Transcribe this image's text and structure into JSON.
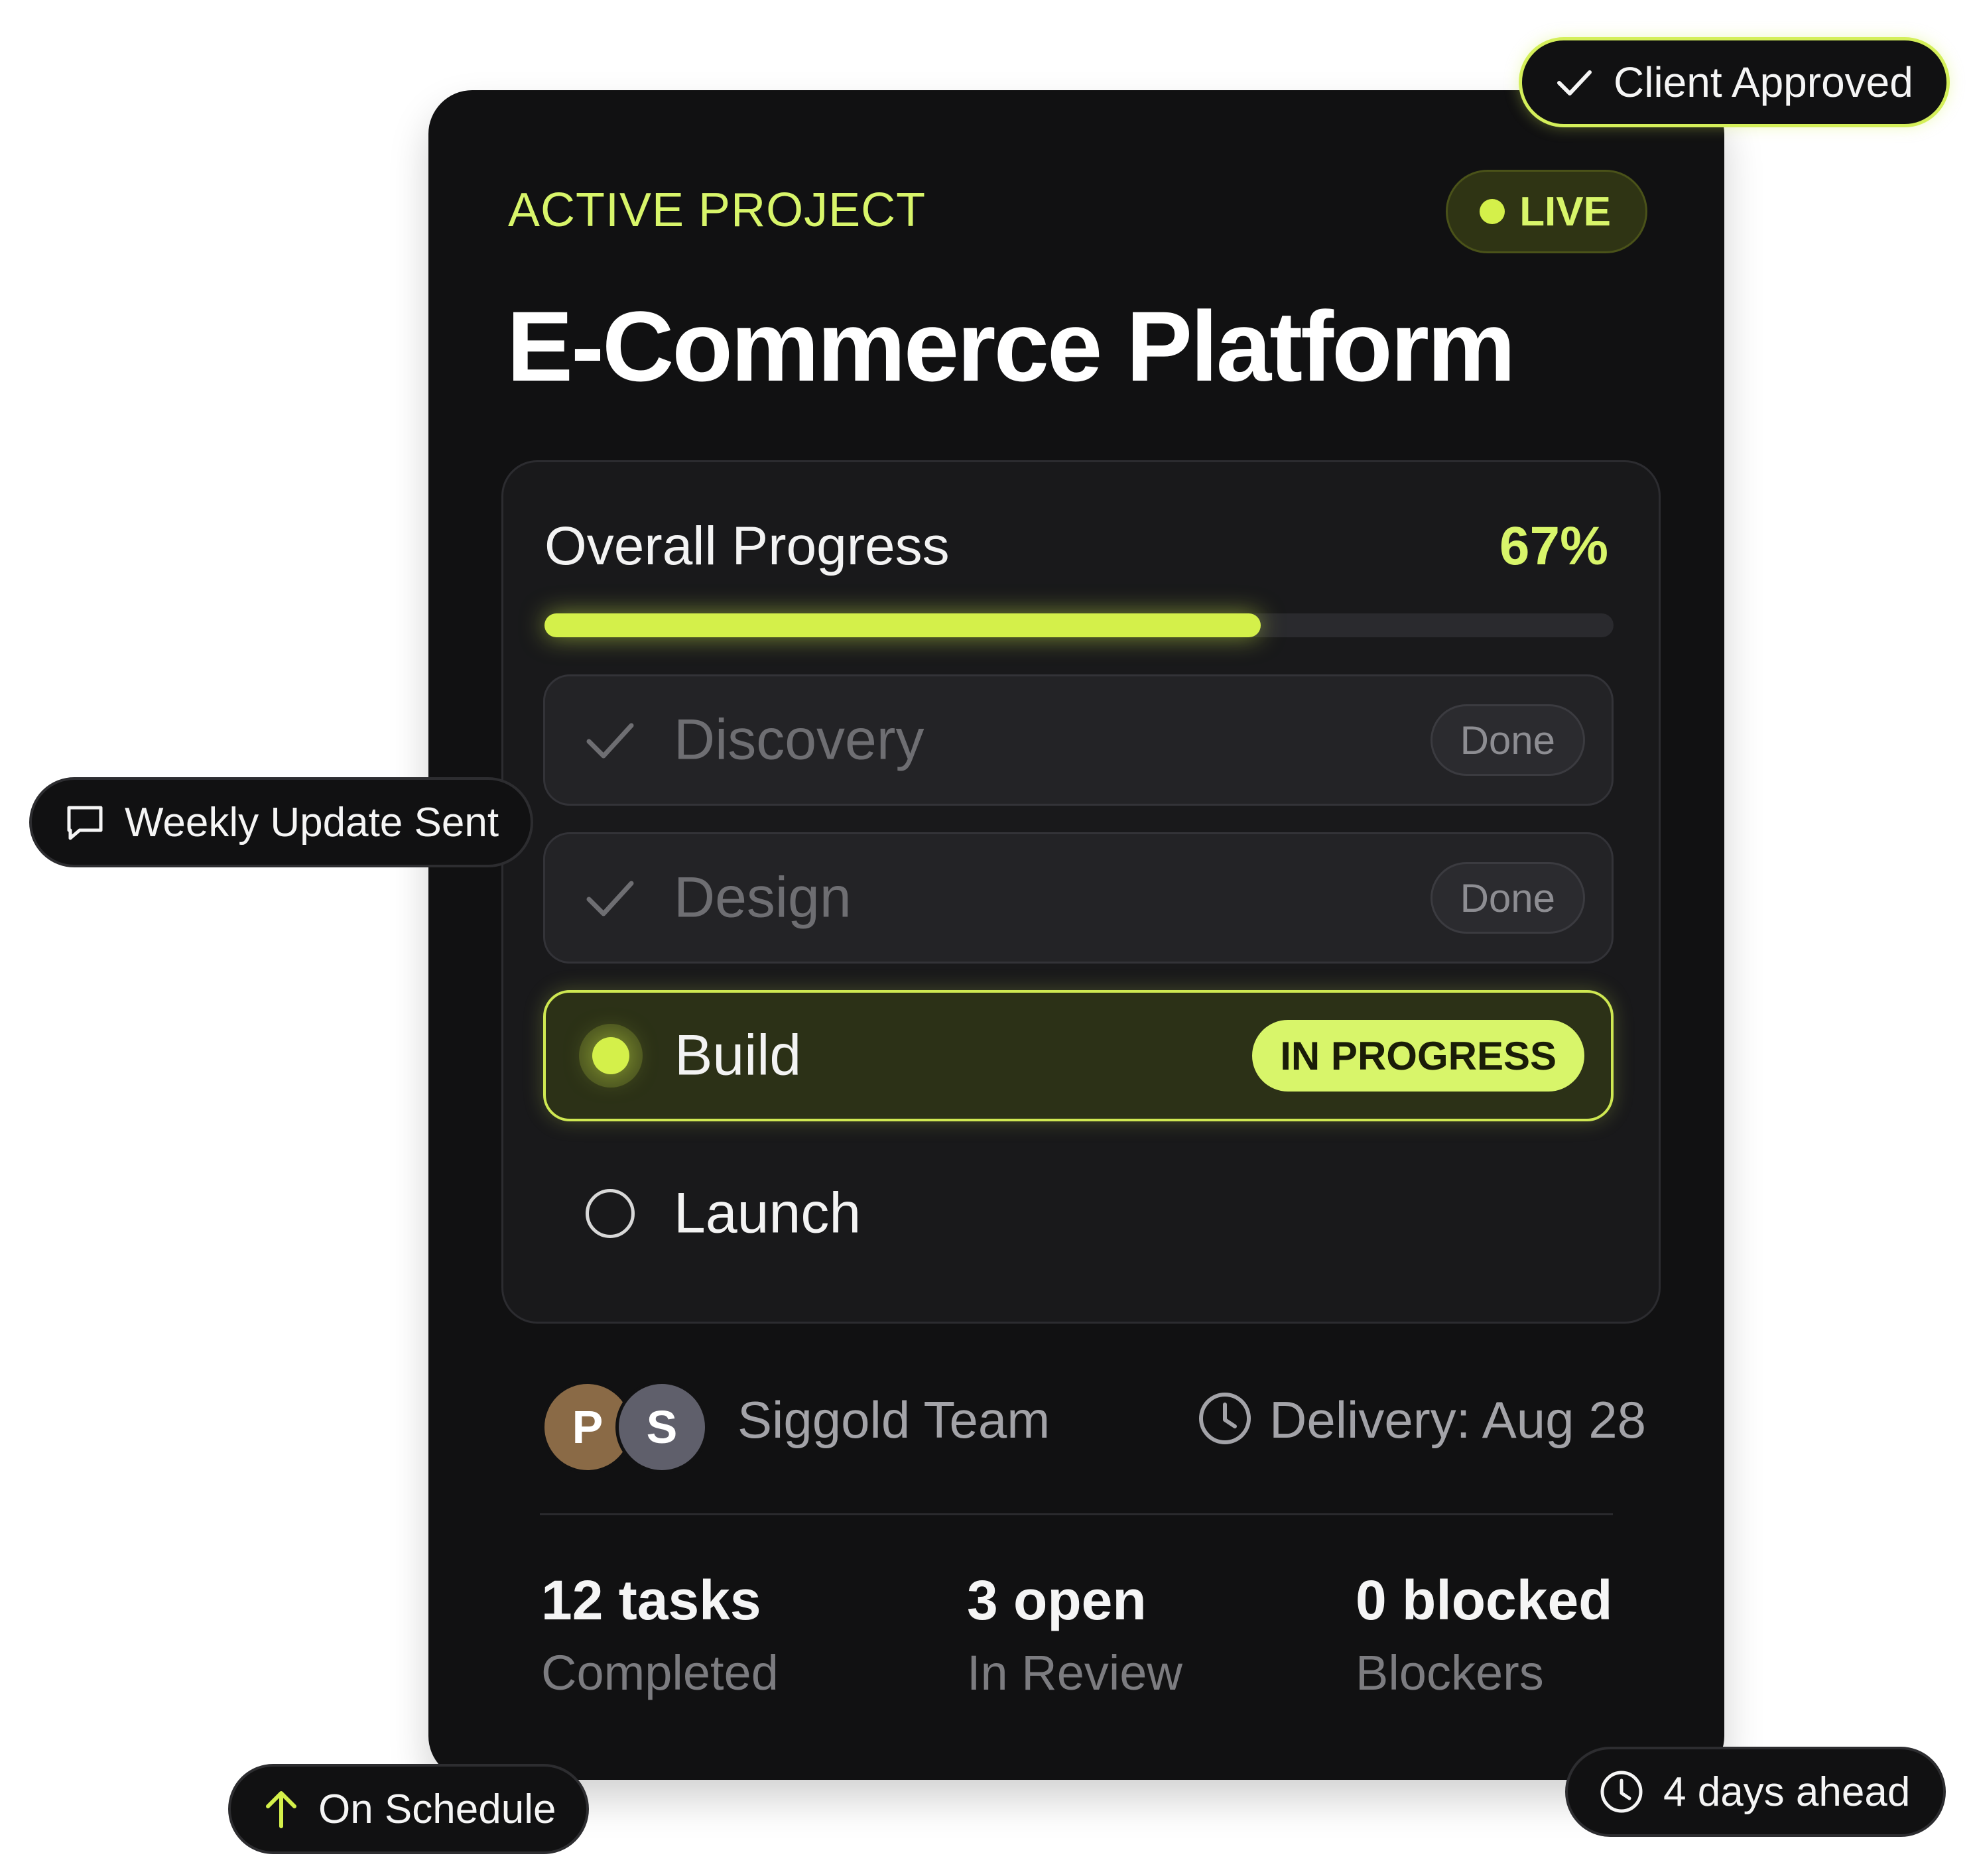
{
  "card": {
    "eyebrow": "ACTIVE PROJECT",
    "live_badge": "LIVE",
    "title": "E-Commerce Platform"
  },
  "progress": {
    "label": "Overall Progress",
    "value_text": "67%",
    "value_fraction": 0.67
  },
  "stages": [
    {
      "label": "Discovery",
      "status": "Done",
      "state": "done"
    },
    {
      "label": "Design",
      "status": "Done",
      "state": "done"
    },
    {
      "label": "Build",
      "status": "IN PROGRESS",
      "state": "active"
    },
    {
      "label": "Launch",
      "status": "",
      "state": "pending"
    }
  ],
  "team": {
    "avatars": [
      {
        "initial": "P",
        "color": "#8a6a46"
      },
      {
        "initial": "S",
        "color": "#5f5f6b"
      }
    ],
    "name": "Siggold Team"
  },
  "delivery": {
    "text": "Delivery: Aug 28",
    "icon": "clock-icon"
  },
  "stats": [
    {
      "value": "12 tasks",
      "label": "Completed"
    },
    {
      "value": "3 open",
      "label": "In Review"
    },
    {
      "value": "0 blocked",
      "label": "Blockers"
    }
  ],
  "floating": {
    "client_approved": {
      "text": "Client Approved",
      "icon": "check-icon"
    },
    "weekly_update": {
      "text": "Weekly Update Sent",
      "icon": "message-icon"
    },
    "on_schedule": {
      "text": "On Schedule",
      "icon": "arrow-up-icon"
    },
    "days_ahead": {
      "text": "4 days ahead",
      "icon": "clock-icon"
    }
  },
  "colors": {
    "accent": "#d4f04a",
    "card_bg": "#111112",
    "panel_bg": "#19191b"
  }
}
